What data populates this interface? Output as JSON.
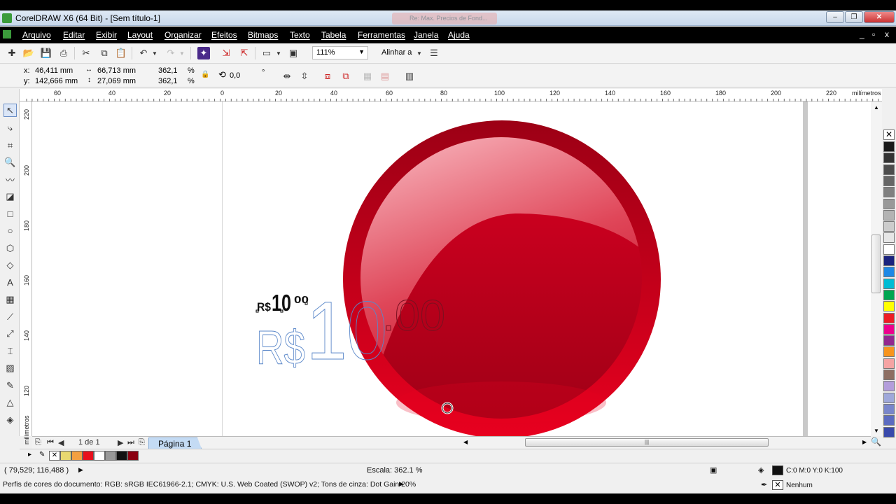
{
  "window": {
    "title": "CorelDRAW X6 (64 Bit) - [Sem título-1]",
    "background_tab": "Re: Max. Precios de Fond...",
    "minimize": "–",
    "restore": "❐",
    "close": "✕"
  },
  "menu": [
    "Arquivo",
    "Editar",
    "Exibir",
    "Layout",
    "Organizar",
    "Efeitos",
    "Bitmaps",
    "Texto",
    "Tabela",
    "Ferramentas",
    "Janela",
    "Ajuda"
  ],
  "menu_controls": {
    "min": "_",
    "restore": "▫",
    "close": "x"
  },
  "toolbar": {
    "zoom": "111%",
    "align_label": "Alinhar a"
  },
  "property_bar": {
    "x_label": "x:",
    "x_value": "46,411 mm",
    "y_label": "y:",
    "y_value": "142,666 mm",
    "width": "66,713 mm",
    "height": "27,069 mm",
    "scale_x": "362,1",
    "scale_y": "362,1",
    "pct": "%",
    "rotation": "0,0",
    "degree": "°"
  },
  "ruler": {
    "top_labels": [
      "60",
      "40",
      "20",
      "0",
      "20",
      "40",
      "60",
      "80",
      "100",
      "120",
      "140",
      "160",
      "180",
      "200",
      "220"
    ],
    "units": "milímetros",
    "left_labels": [
      "220",
      "200",
      "180",
      "160",
      "140",
      "120"
    ],
    "left_units": "milímetros"
  },
  "canvas": {
    "price_small": {
      "currency": "R$",
      "main": "10",
      "cents": "00"
    },
    "price_outline": {
      "currency": "R$",
      "main": "10",
      "cents": ".00"
    }
  },
  "page_nav": {
    "counter": "1 de 1",
    "tab": "Página 1"
  },
  "status": {
    "coords": "( 79,529; 116,488 )",
    "scale": "Escala: 362.1 %",
    "fill": "C:0 M:0 Y:0 K:100",
    "outline": "Nenhum",
    "color_profiles": "Perfis de cores do documento: RGB: sRGB IEC61966-2.1; CMYK: U.S. Web Coated (SWOP) v2; Tons de cinza: Dot Gain 20%"
  },
  "colors": {
    "circle_outer": "#b0001a",
    "circle_inner": "#d0001e",
    "accent": "#3b9b3b"
  },
  "palette_colors": [
    "#1a1a1a",
    "#333333",
    "#4d4d4d",
    "#666666",
    "#808080",
    "#999999",
    "#b3b3b3",
    "#cccccc",
    "#e6e6e6",
    "#ffffff",
    "#1a237e",
    "#1e88e5",
    "#00bcd4",
    "#00a651",
    "#ffff00",
    "#ed1c24",
    "#ec008c",
    "#92278f",
    "#f7941d",
    "#f5a3a3",
    "#8d6e63",
    "#b39ddb",
    "#9fa8da",
    "#7986cb",
    "#5c6bc0",
    "#3949ab"
  ],
  "doc_palette": [
    "#e8d870",
    "#f4a040",
    "#e8101c",
    "#ffffff",
    "#999999",
    "#111111",
    "#8a0010"
  ]
}
